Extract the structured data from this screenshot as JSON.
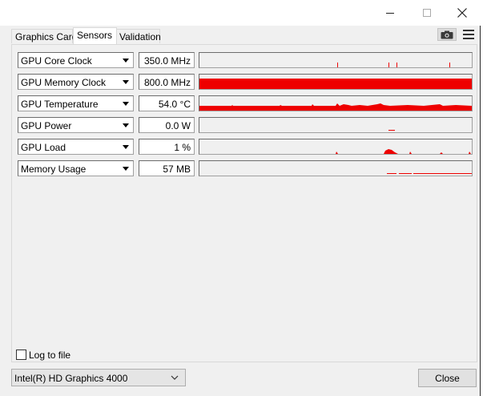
{
  "window": {
    "minimize_icon": "minimize-icon",
    "maximize_icon": "maximize-icon",
    "close_icon": "close-icon"
  },
  "tabs": [
    {
      "label": "Graphics Card",
      "active": false
    },
    {
      "label": "Sensors",
      "active": true
    },
    {
      "label": "Validation",
      "active": false
    }
  ],
  "toolbar": {
    "screenshot_icon": "camera-icon",
    "menu_icon": "hamburger-menu-icon"
  },
  "sensors": [
    {
      "name": "GPU Core Clock",
      "value": "350.0 MHz"
    },
    {
      "name": "GPU Memory Clock",
      "value": "800.0 MHz"
    },
    {
      "name": "GPU Temperature",
      "value": "54.0 °C"
    },
    {
      "name": "GPU Power",
      "value": "0.0 W"
    },
    {
      "name": "GPU Load",
      "value": "1 %"
    },
    {
      "name": "Memory Usage",
      "value": "57 MB"
    }
  ],
  "footer": {
    "log_to_file_label": "Log to file",
    "log_to_file_checked": false,
    "device_selected": "Intel(R) HD Graphics 4000",
    "close_label": "Close"
  },
  "colors": {
    "graph_line": "#ee0000",
    "window_bg": "#f0f0f0"
  }
}
